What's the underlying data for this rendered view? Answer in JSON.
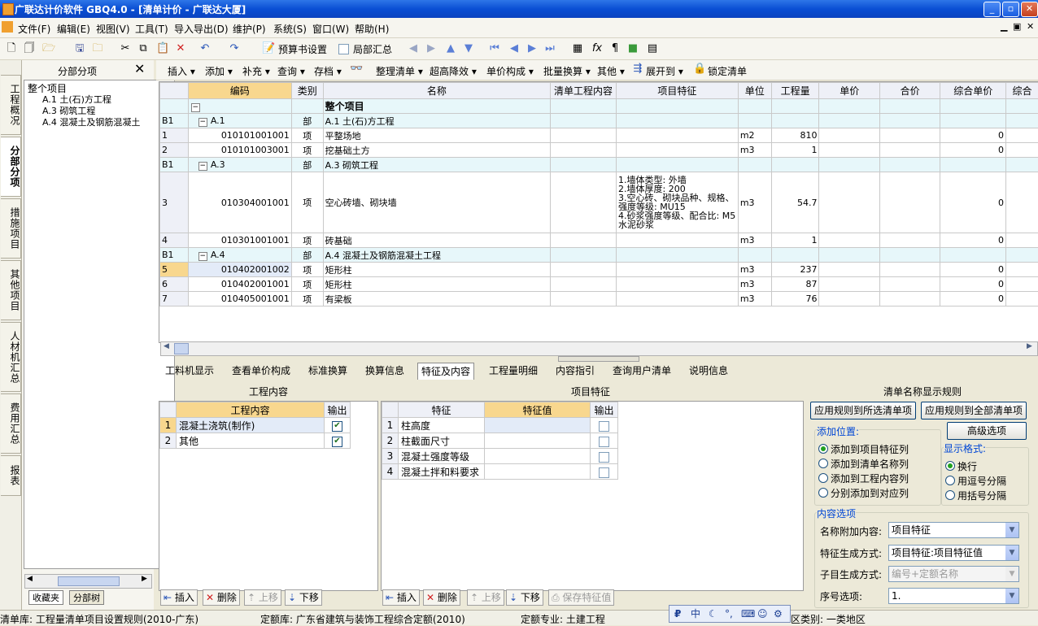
{
  "window": {
    "title": "广联达计价软件 GBQ4.0 - [清单计价 - 广联达大厦]"
  },
  "menu": [
    "文件(F)",
    "编辑(E)",
    "视图(V)",
    "工具(T)",
    "导入导出(D)",
    "维护(P)",
    "系统(S)",
    "窗口(W)",
    "帮助(H)"
  ],
  "toolbar1": {
    "budget_settings": "预算书设置",
    "partial_summary": "局部汇总"
  },
  "left_tabs": [
    "工程概况",
    "分部分项",
    "措施项目",
    "其他项目",
    "人材机汇总",
    "费用汇总",
    "报表"
  ],
  "tree": {
    "title": "分部分项",
    "root": "整个项目",
    "items": [
      "A.1 土(石)方工程",
      "A.3 砌筑工程",
      "A.4 混凝土及钢筋混凝土"
    ],
    "bottom_tabs": [
      "收藏夹",
      "分部树"
    ]
  },
  "toolbar2": [
    "插入",
    "添加",
    "补充",
    "查询",
    "存档",
    "整理清单",
    "超高降效",
    "单价构成",
    "批量换算",
    "其他",
    "展开到",
    "锁定清单"
  ],
  "grid": {
    "headers": [
      "编码",
      "类别",
      "名称",
      "清单工程内容",
      "项目特征",
      "单位",
      "工程量",
      "单价",
      "合价",
      "综合单价",
      "综合"
    ],
    "top_row": {
      "name": "整个项目"
    },
    "rows": [
      {
        "num": "B1",
        "code": "A.1",
        "type": "部",
        "name": "A.1 土(石)方工程",
        "feature": "",
        "unit": "",
        "qty": "",
        "uprice": "",
        "section": true
      },
      {
        "num": "1",
        "code": "010101001001",
        "type": "项",
        "name": "平整场地",
        "feature": "",
        "unit": "m2",
        "qty": "810",
        "uprice": "0",
        "section": false
      },
      {
        "num": "2",
        "code": "010101003001",
        "type": "项",
        "name": "挖基础土方",
        "feature": "",
        "unit": "m3",
        "qty": "1",
        "uprice": "0",
        "section": false
      },
      {
        "num": "B1",
        "code": "A.3",
        "type": "部",
        "name": "A.3 砌筑工程",
        "feature": "",
        "unit": "",
        "qty": "",
        "uprice": "",
        "section": true
      },
      {
        "num": "3",
        "code": "010304001001",
        "type": "项",
        "name": "空心砖墙、砌块墙",
        "feature": "1.墙体类型: 外墙\n2.墙体厚度: 200\n3.空心砖、砌块品种、规格、强度等级: MU15\n4.砂浆强度等级、配合比: M5水泥砂浆",
        "unit": "m3",
        "qty": "54.7",
        "uprice": "0",
        "section": false
      },
      {
        "num": "4",
        "code": "010301001001",
        "type": "项",
        "name": "砖基础",
        "feature": "",
        "unit": "m3",
        "qty": "1",
        "uprice": "0",
        "section": false
      },
      {
        "num": "B1",
        "code": "A.4",
        "type": "部",
        "name": "A.4 混凝土及钢筋混凝土工程",
        "feature": "",
        "unit": "",
        "qty": "",
        "uprice": "",
        "section": true
      },
      {
        "num": "5",
        "code": "010402001002",
        "type": "项",
        "name": "矩形柱",
        "feature": "",
        "unit": "m3",
        "qty": "237",
        "uprice": "0",
        "section": false,
        "selected": true
      },
      {
        "num": "6",
        "code": "010402001001",
        "type": "项",
        "name": "矩形柱",
        "feature": "",
        "unit": "m3",
        "qty": "87",
        "uprice": "0",
        "section": false
      },
      {
        "num": "7",
        "code": "010405001001",
        "type": "项",
        "name": "有梁板",
        "feature": "",
        "unit": "m3",
        "qty": "76",
        "uprice": "0",
        "section": false
      }
    ]
  },
  "bottom_tabs": [
    "工料机显示",
    "查看单价构成",
    "标准换算",
    "换算信息",
    "特征及内容",
    "工程量明细",
    "内容指引",
    "查询用户清单",
    "说明信息"
  ],
  "content_panel": {
    "title": "工程内容",
    "headers": [
      "工程内容",
      "输出"
    ],
    "rows": [
      {
        "num": "1",
        "name": "混凝土浇筑(制作)",
        "checked": true
      },
      {
        "num": "2",
        "name": "其他",
        "checked": true
      }
    ],
    "buttons": [
      "插入",
      "删除",
      "上移",
      "下移"
    ]
  },
  "feature_panel": {
    "title": "项目特征",
    "headers": [
      "特征",
      "特征值",
      "输出"
    ],
    "rows": [
      {
        "num": "1",
        "name": "柱高度",
        "checked": false
      },
      {
        "num": "2",
        "name": "柱截面尺寸",
        "checked": false
      },
      {
        "num": "3",
        "name": "混凝土强度等级",
        "checked": false
      },
      {
        "num": "4",
        "name": "混凝土拌和料要求",
        "checked": false
      }
    ],
    "buttons": [
      "插入",
      "删除",
      "上移",
      "下移",
      "保存特征值"
    ]
  },
  "rules_panel": {
    "title": "清单名称显示规则",
    "apply_selected": "应用规则到所选清单项",
    "apply_all": "应用规则到全部清单项",
    "advanced": "高级选项",
    "add_position_title": "添加位置:",
    "add_positions": [
      "添加到项目特征列",
      "添加到清单名称列",
      "添加到工程内容列",
      "分别添加到对应列"
    ],
    "display_format_title": "显示格式:",
    "display_formats": [
      "换行",
      "用逗号分隔",
      "用括号分隔"
    ],
    "content_options_title": "内容选项",
    "name_append_label": "名称附加内容:",
    "name_append_value": "项目特征",
    "feature_mode_label": "特征生成方式:",
    "feature_mode_value": "项目特征:项目特征值",
    "sub_mode_label": "子目生成方式:",
    "sub_mode_value": "编号+定额名称",
    "seq_label": "序号选项:",
    "seq_value": "1."
  },
  "statusbar": {
    "bill_lib": "清单库: 工程量清单项目设置规则(2010-广东)",
    "quota_lib": "定额库: 广东省建筑与装饰工程综合定额(2010)",
    "quota_major": "定额专业: 土建工程",
    "region": "区类别: 一类地区"
  },
  "colors": {
    "header_selected": "#f8d78e",
    "section_row": "#e7f7fa",
    "title_bar": "#0a4fd4"
  }
}
